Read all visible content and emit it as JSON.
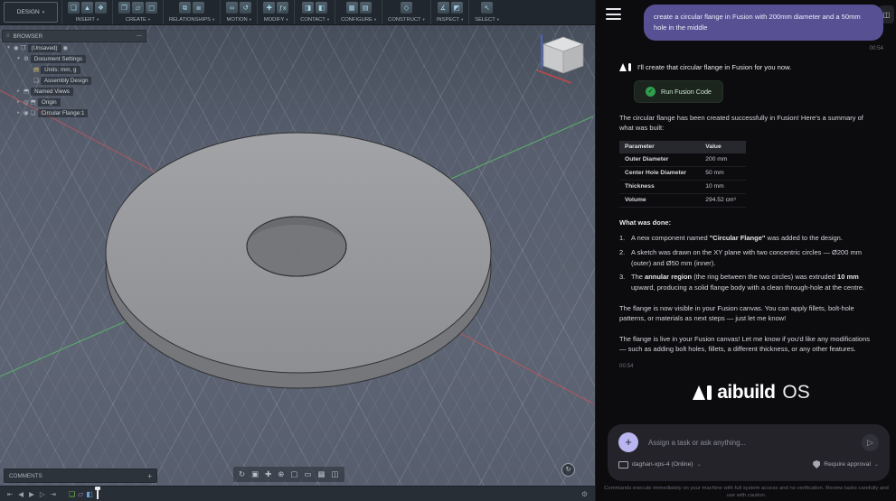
{
  "colors": {
    "bubble_purple": "#575093",
    "plus_lavender": "#b9b5ef",
    "run_green_text": "#cde8cf",
    "check_green": "#2f9e4f",
    "viewport_bg": "#5a6170",
    "axis_red": "#c8555a",
    "axis_green": "#5cc46a"
  },
  "fusion": {
    "design_label": "DESIGN",
    "browser_title": "BROWSER",
    "comments_label": "COMMENTS",
    "comments_add": "+",
    "gear_glyph": "⚙",
    "orbit_glyph": "↻",
    "toolbar_groups": [
      {
        "label": "INSERT",
        "icons": [
          {
            "name": "insert-derive-icon",
            "glyph": "❏"
          },
          {
            "name": "insert-mesh-icon",
            "glyph": "▲"
          },
          {
            "name": "insert-parts-icon",
            "glyph": "❖"
          }
        ]
      },
      {
        "label": "CREATE",
        "icons": [
          {
            "name": "new-component-icon",
            "glyph": "❐"
          },
          {
            "name": "create-sketch-icon",
            "glyph": "▱"
          },
          {
            "name": "create-section-icon",
            "glyph": "▢"
          }
        ]
      },
      {
        "label": "RELATIONSHIPS",
        "icons": [
          {
            "name": "joint-icon",
            "glyph": "⧉"
          },
          {
            "name": "rigid-group-icon",
            "glyph": "⧈"
          }
        ]
      },
      {
        "label": "MOTION",
        "icons": [
          {
            "name": "motion-link-icon",
            "glyph": "∞"
          },
          {
            "name": "motion-study-icon",
            "glyph": "↺"
          }
        ]
      },
      {
        "label": "MODIFY",
        "icons": [
          {
            "name": "move-icon",
            "glyph": "✚"
          },
          {
            "name": "change-parameters-icon",
            "glyph": "ƒx"
          }
        ]
      },
      {
        "label": "CONTACT",
        "icons": [
          {
            "name": "contact-sets-icon",
            "glyph": "◨"
          },
          {
            "name": "contact-pair-icon",
            "glyph": "◧"
          }
        ]
      },
      {
        "label": "CONFIGURE",
        "icons": [
          {
            "name": "configure-icon",
            "glyph": "▦"
          },
          {
            "name": "configuration-table-icon",
            "glyph": "▤"
          }
        ]
      },
      {
        "label": "CONSTRUCT",
        "icons": [
          {
            "name": "construct-plane-icon",
            "glyph": "◇"
          }
        ]
      },
      {
        "label": "INSPECT",
        "icons": [
          {
            "name": "measure-icon",
            "glyph": "∡"
          },
          {
            "name": "section-analysis-icon",
            "glyph": "◩"
          }
        ]
      },
      {
        "label": "SELECT",
        "icons": [
          {
            "name": "select-cursor-icon",
            "glyph": "↖"
          }
        ]
      }
    ],
    "tree": [
      {
        "depth": 0,
        "caret": "▾",
        "icons": [
          {
            "name": "eye-icon",
            "glyph": "◉"
          },
          {
            "name": "document-icon",
            "glyph": "❐"
          }
        ],
        "label": "(Unsaved)",
        "trail": [
          {
            "name": "save-status-icon",
            "glyph": "◉"
          }
        ]
      },
      {
        "depth": 1,
        "caret": "▾",
        "icons": [
          {
            "name": "gear-icon",
            "glyph": "⚙"
          }
        ],
        "label": "Document Settings"
      },
      {
        "depth": 2,
        "caret": "",
        "icons": [
          {
            "name": "units-doc-icon",
            "glyph": "▤",
            "color": "#ddc36a"
          }
        ],
        "label": "Units: mm, g"
      },
      {
        "depth": 2,
        "caret": "",
        "icons": [
          {
            "name": "assembly-icon",
            "glyph": "❏"
          }
        ],
        "label": "Assembly Design"
      },
      {
        "depth": 1,
        "caret": "▸",
        "icons": [
          {
            "name": "folder-icon",
            "glyph": "⬒"
          }
        ],
        "label": "Named Views"
      },
      {
        "depth": 1,
        "caret": "▸",
        "icons": [
          {
            "name": "link-eye-icon",
            "glyph": "◎"
          },
          {
            "name": "folder-icon",
            "glyph": "⬒"
          }
        ],
        "label": "Origin"
      },
      {
        "depth": 1,
        "caret": "▸",
        "icons": [
          {
            "name": "eye-icon",
            "glyph": "◉"
          },
          {
            "name": "component-icon",
            "glyph": "❏"
          }
        ],
        "label": "Circular Flange:1"
      }
    ],
    "nav_icons": [
      {
        "name": "orbit-icon",
        "glyph": "↻"
      },
      {
        "name": "look-at-icon",
        "glyph": "▣"
      },
      {
        "name": "pan-icon",
        "glyph": "✚"
      },
      {
        "name": "zoom-icon",
        "glyph": "⊕"
      },
      {
        "name": "fit-icon",
        "glyph": "▢"
      },
      {
        "name": "display-settings-icon",
        "glyph": "▭"
      },
      {
        "name": "grid-settings-icon",
        "glyph": "▦"
      },
      {
        "name": "viewports-icon",
        "glyph": "◫"
      }
    ],
    "playback_icons": [
      {
        "name": "skip-to-start-icon",
        "glyph": "⇤"
      },
      {
        "name": "step-back-icon",
        "glyph": "◀"
      },
      {
        "name": "play-icon",
        "glyph": "▶"
      },
      {
        "name": "step-forward-icon",
        "glyph": "▷"
      },
      {
        "name": "skip-to-end-icon",
        "glyph": "⇥"
      }
    ],
    "feature_icons": [
      {
        "name": "component-feature-icon",
        "glyph": "❏",
        "color": "#7ac142"
      },
      {
        "name": "sketch-feature-icon",
        "glyph": "▱",
        "color": "#b48ce0"
      },
      {
        "name": "extrude-feature-icon",
        "glyph": "◧",
        "color": "#6aa0d8"
      }
    ]
  },
  "chat": {
    "user_message": "create a circular flange in Fusion with 200mm diameter and a 50mm hole in the middle",
    "user_time": "00:54",
    "ai_intro": "I'll create that circular flange in Fusion for you now.",
    "run_button_label": "Run Fusion Code",
    "check_glyph": "✓",
    "summary": "The circular flange has been created successfully in Fusion! Here's a summary of what was built:",
    "table": {
      "headers": [
        "Parameter",
        "Value"
      ],
      "rows": [
        [
          "Outer Diameter",
          "200 mm"
        ],
        [
          "Center Hole Diameter",
          "50 mm"
        ],
        [
          "Thickness",
          "10 mm"
        ],
        [
          "Volume",
          "294.52 cm³"
        ]
      ]
    },
    "what_was_done": "What was done:",
    "steps": [
      [
        [
          "A new component named ",
          false
        ],
        [
          "\"Circular Flange\"",
          true
        ],
        [
          " was added to the design.",
          false
        ]
      ],
      [
        [
          "A sketch was drawn on the XY plane with two concentric circles — Ø200 mm (outer) and Ø50 mm (inner).",
          false
        ]
      ],
      [
        [
          "The ",
          false
        ],
        [
          "annular region",
          true
        ],
        [
          " (the ring between the two circles) was extruded ",
          false
        ],
        [
          "10 mm",
          true
        ],
        [
          " upward, producing a solid flange body with a clean through-hole at the centre.",
          false
        ]
      ]
    ],
    "p1": "The flange is now visible in your Fusion canvas. You can apply fillets, bolt-hole patterns, or materials as next steps — just let me know!",
    "p2": "The flange is live in your Fusion canvas! Let me know if you'd like any modifications — such as adding bolt holes, fillets, a different thickness, or any other features.",
    "ai_time": "00:54",
    "brand_name": "aibuild",
    "brand_suffix": "OS",
    "input_placeholder": "Assign a task or ask anything...",
    "plus_glyph": "+",
    "send_glyph": "▷",
    "device": "daghan-xps-4 (Online)",
    "approval": "Require approval",
    "disclaimer": "Commands execute immediately on your machine with full system access and no verification. Review tasks carefully and use with caution."
  }
}
